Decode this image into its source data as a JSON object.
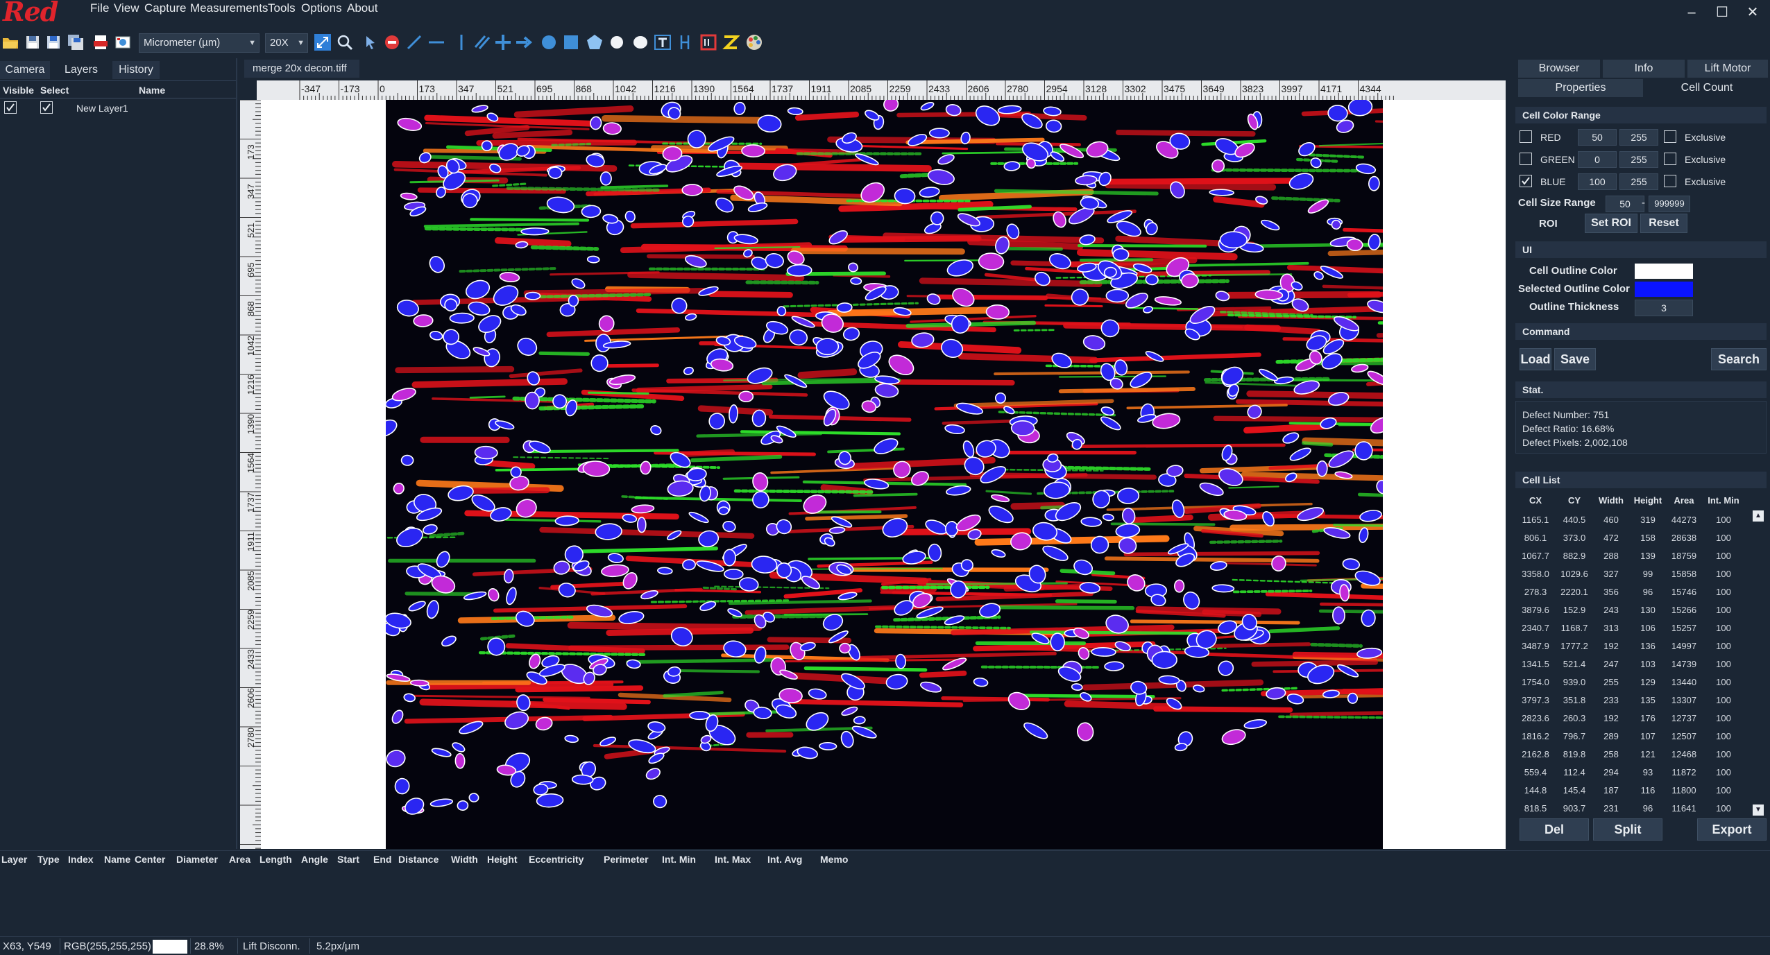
{
  "app": {
    "logo": "Red"
  },
  "menu": [
    "File",
    "View",
    "Capture",
    "Measurements",
    "Tools",
    "Options",
    "About"
  ],
  "toolbar": {
    "unit_select": "Micrometer (µm)",
    "magnification_select": "20X",
    "icons": [
      "open-folder-icon",
      "save-icon",
      "save-as-icon",
      "save-all-icon",
      "pdf-icon",
      "image-export-icon",
      "zoom-fit-icon",
      "zoom-icon",
      "pointer-icon",
      "delete-icon",
      "line-tool-icon",
      "hline-tool-icon",
      "vline-tool-icon",
      "parallel-tool-icon",
      "cross-tool-icon",
      "arrow-tool-icon",
      "circle-tool-icon",
      "rectangle-tool-icon",
      "polygon-tool-icon",
      "white-circle-icon",
      "ellipse-icon",
      "text-tool-icon",
      "vertical-measure-icon",
      "scale-bar-icon",
      "z-icon",
      "color-palette-icon"
    ]
  },
  "left_panel": {
    "tabs": [
      "Camera",
      "Layers",
      "History"
    ],
    "active_tab": "Layers",
    "columns": [
      "Visible",
      "Select",
      "Name"
    ],
    "layers": [
      {
        "visible": true,
        "selected": true,
        "name": "New Layer1"
      }
    ]
  },
  "document_tab": "merge 20x decon.tiff",
  "ruler": {
    "horizontal": [
      "-347",
      "-173",
      "0",
      "173",
      "347",
      "521",
      "695",
      "868",
      "1042",
      "1216",
      "1390",
      "1564",
      "1737",
      "1911",
      "2085",
      "2259",
      "2433",
      "2606",
      "2780",
      "2954",
      "3128",
      "3302",
      "3475",
      "3649",
      "3823",
      "3997",
      "4171",
      "4344"
    ],
    "vertical": [
      "173",
      "347",
      "521",
      "695",
      "868",
      "1042",
      "1216",
      "1390",
      "1564",
      "1737",
      "1911",
      "2085",
      "2259",
      "2433",
      "2606",
      "2780"
    ]
  },
  "right_panel": {
    "tabs_row1": [
      "Browser",
      "Info",
      "Lift Motor"
    ],
    "tabs_row2": [
      "Properties",
      "Cell Count"
    ],
    "active_tab": "Cell Count",
    "cell_color_range": {
      "title": "Cell Color Range",
      "channels": [
        {
          "name": "RED",
          "checked": false,
          "min": "50",
          "max": "255",
          "exclusive_label": "Exclusive",
          "exclusive": false
        },
        {
          "name": "GREEN",
          "checked": false,
          "min": "0",
          "max": "255",
          "exclusive_label": "Exclusive",
          "exclusive": false
        },
        {
          "name": "BLUE",
          "checked": true,
          "min": "100",
          "max": "255",
          "exclusive_label": "Exclusive",
          "exclusive": false
        }
      ],
      "size_label": "Cell Size Range",
      "size_min": "50",
      "size_sep": "-",
      "size_max": "999999",
      "roi_label": "ROI",
      "set_roi": "Set ROI",
      "reset": "Reset"
    },
    "ui": {
      "title": "UI",
      "cell_outline_color_label": "Cell Outline Color",
      "cell_outline_color": "#ffffff",
      "selected_outline_color_label": "Selected Outline Color",
      "selected_outline_color": "#0a14ff",
      "outline_thickness_label": "Outline Thickness",
      "outline_thickness": "3"
    },
    "command": {
      "title": "Command",
      "load": "Load",
      "save": "Save",
      "search": "Search"
    },
    "stat": {
      "title": "Stat.",
      "defect_number": "Defect Number: 751",
      "defect_ratio": "Defect Ratio: 16.68%",
      "defect_pixels": "Defect Pixels: 2,002,108"
    },
    "cell_list": {
      "title": "Cell List",
      "columns": [
        "CX",
        "CY",
        "Width",
        "Height",
        "Area",
        "Int. Min"
      ],
      "rows": [
        [
          "1165.1",
          "440.5",
          "460",
          "319",
          "44273",
          "100"
        ],
        [
          "806.1",
          "373.0",
          "472",
          "158",
          "28638",
          "100"
        ],
        [
          "1067.7",
          "882.9",
          "288",
          "139",
          "18759",
          "100"
        ],
        [
          "3358.0",
          "1029.6",
          "327",
          "99",
          "15858",
          "100"
        ],
        [
          "278.3",
          "2220.1",
          "356",
          "96",
          "15746",
          "100"
        ],
        [
          "3879.6",
          "152.9",
          "243",
          "130",
          "15266",
          "100"
        ],
        [
          "2340.7",
          "1168.7",
          "313",
          "106",
          "15257",
          "100"
        ],
        [
          "3487.9",
          "1777.2",
          "192",
          "136",
          "14997",
          "100"
        ],
        [
          "1341.5",
          "521.4",
          "247",
          "103",
          "14739",
          "100"
        ],
        [
          "1754.0",
          "939.0",
          "255",
          "129",
          "13440",
          "100"
        ],
        [
          "3797.3",
          "351.8",
          "233",
          "135",
          "13307",
          "100"
        ],
        [
          "2823.6",
          "260.3",
          "192",
          "176",
          "12737",
          "100"
        ],
        [
          "1816.2",
          "796.7",
          "289",
          "107",
          "12507",
          "100"
        ],
        [
          "2162.8",
          "819.8",
          "258",
          "121",
          "12468",
          "100"
        ],
        [
          "559.4",
          "112.4",
          "294",
          "93",
          "11872",
          "100"
        ],
        [
          "144.8",
          "145.4",
          "187",
          "116",
          "11800",
          "100"
        ],
        [
          "818.5",
          "903.7",
          "231",
          "96",
          "11641",
          "100"
        ]
      ],
      "del": "Del",
      "split": "Split",
      "export": "Export"
    }
  },
  "measure_table": {
    "columns": [
      "Layer",
      "Type",
      "Index",
      "Name",
      "Center",
      "Diameter",
      "Area",
      "Length",
      "Angle",
      "Start",
      "End",
      "Distance",
      "Width",
      "Height",
      "Eccentricity",
      "Perimeter",
      "Int. Min",
      "Int. Max",
      "Int. Avg",
      "Memo"
    ]
  },
  "status": {
    "coords": "X63, Y549",
    "rgb": "RGB(255,255,255)",
    "swatch_color": "#ffffff",
    "zoom": "28.8%",
    "lift": "Lift Disconn.",
    "scale": "5.2px/µm"
  }
}
